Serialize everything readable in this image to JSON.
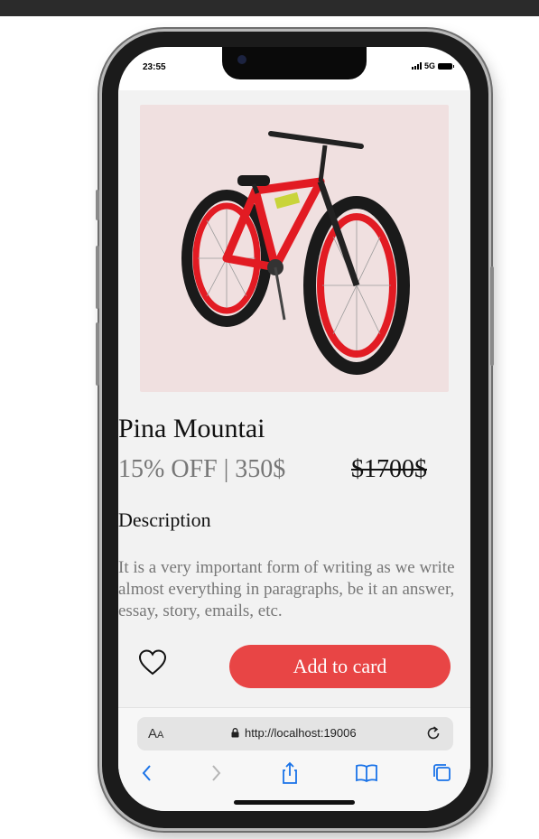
{
  "status": {
    "time": "23:55",
    "network": "5G"
  },
  "product": {
    "name": "Pina Mountai",
    "price_line": "15% OFF | 350$",
    "old_price": "$1700$",
    "description_heading": "Description",
    "description": "It is a very important form of writing as we write almost everything in paragraphs, be it an answer, essay, story, emails, etc.",
    "image_alt": "red mountain bike"
  },
  "actions": {
    "favorite_icon": "heart-icon",
    "add_label": "Add to card"
  },
  "browser": {
    "aa_label_big": "A",
    "aa_label_small": "A",
    "url": "http://localhost:19006",
    "icons": [
      "back-icon",
      "forward-icon",
      "share-icon",
      "bookmarks-icon",
      "tabs-icon"
    ]
  },
  "colors": {
    "accent": "#e84545",
    "image_bg": "#f0e0e0",
    "nav_icon": "#1a73e8"
  }
}
